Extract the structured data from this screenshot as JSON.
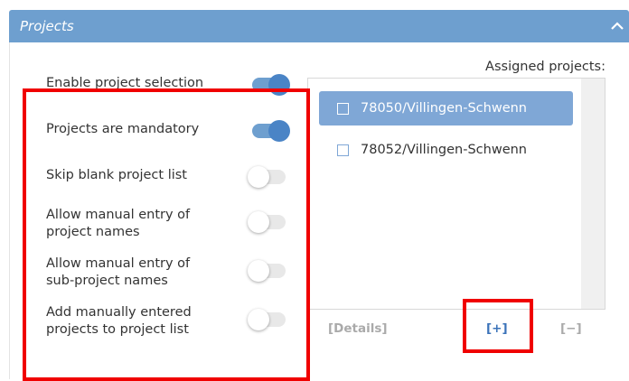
{
  "panel": {
    "title": "Projects"
  },
  "settings": [
    {
      "label": "Enable project selection",
      "on": true
    },
    {
      "label": "Projects are mandatory",
      "on": true
    },
    {
      "label": "Skip blank project list",
      "on": false
    },
    {
      "label_line1": "Allow manual entry of",
      "label_line2": "project names",
      "on": false
    },
    {
      "label_line1": "Allow manual entry of",
      "label_line2": "sub-project names",
      "on": false
    },
    {
      "label_line1": "Add manually entered",
      "label_line2": "projects to project list",
      "on": false
    }
  ],
  "assigned": {
    "label": "Assigned projects:",
    "items": [
      {
        "name": "78050/Villingen-Schwenn",
        "selected": true
      },
      {
        "name": "78052/Villingen-Schwenn",
        "selected": false
      }
    ]
  },
  "footer": {
    "details": "[Details]",
    "add": "[+]",
    "remove": "[−]"
  },
  "colors": {
    "accent": "#6e9fcf",
    "toggle_on": "#4a84c6",
    "highlight_box": "#f00000"
  },
  "icons": {
    "collapse": "chevron-up-icon"
  }
}
